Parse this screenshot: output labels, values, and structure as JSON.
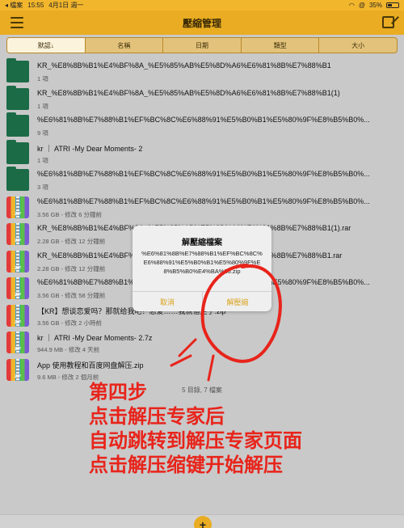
{
  "status_bar": {
    "left_items": [
      "◂ 檔案",
      "15:55",
      "4月1日 週一"
    ],
    "wifi": "wifi-icon",
    "compass": "@",
    "battery": "35%"
  },
  "nav": {
    "title": "壓縮管理",
    "left_icon": "menu-icon",
    "right_icon": "compose-icon"
  },
  "tabs": [
    {
      "label": "默認↓",
      "active": true
    },
    {
      "label": "名稱",
      "active": false
    },
    {
      "label": "日期",
      "active": false
    },
    {
      "label": "類型",
      "active": false
    },
    {
      "label": "大小",
      "active": false
    }
  ],
  "files": [
    {
      "type": "folder",
      "name": "KR_%E8%8B%B1%E4%BF%8A_%E5%85%AB%E5%8D%A6%E6%81%8B%E7%88%B1",
      "sub": "1 項"
    },
    {
      "type": "folder",
      "name": "KR_%E8%8B%B1%E4%BF%8A_%E5%85%AB%E5%8D%A6%E6%81%8B%E7%88%B1(1)",
      "sub": "1 項"
    },
    {
      "type": "folder",
      "name": "%E6%81%8B%E7%88%B1%EF%BC%8C%E6%88%91%E5%B0%B1%E5%80%9F%E8%B5%B0%...",
      "sub": "9 項"
    },
    {
      "type": "folder",
      "name": "kr ｜ ATRI -My Dear Moments- 2",
      "sub": "1 項"
    },
    {
      "type": "folder",
      "name": "%E6%81%8B%E7%88%B1%EF%BC%8C%E6%88%91%E5%B0%B1%E5%80%9F%E8%B5%B0%...",
      "sub": "3 項"
    },
    {
      "type": "zip",
      "name": "%E6%81%8B%E7%88%B1%EF%BC%8C%E6%88%91%E5%B0%B1%E5%80%9F%E8%B5%B0%...",
      "sub": "3.56 GB - 修改 6 分鐘前"
    },
    {
      "type": "zip",
      "name": "KR_%E8%8B%B1%E4%BF%8A_%E5%85%AB%E5%8D%A6%E6%81%8B%E7%88%B1(1).rar",
      "sub": "2.28 GB - 修改 12 分鐘前"
    },
    {
      "type": "zip",
      "name": "KR_%E8%8B%B1%E4%BF%8A_%E5%85%AB%E5%8D%A6%E6%81%8B%E7%88%B1.rar",
      "sub": "2.28 GB - 修改 12 分鐘前"
    },
    {
      "type": "zip",
      "name": "%E6%81%8B%E7%88%B1%EF%BC%8C%E6%88%91%E5%B0%B1%E5%80%9F%E8%B5%B0%...",
      "sub": "3.56 GB - 修改 58 分鐘前"
    },
    {
      "type": "zip",
      "name": "【KR】想谈恋爱吗？那就给我吧！恋爱……我就借走了.zip",
      "sub": "3.56 GB - 修改 2 小時前"
    },
    {
      "type": "zip",
      "name": "kr ｜ ATRI -My Dear Moments- 2.7z",
      "sub": "944.9 MB - 修改 4 天前"
    },
    {
      "type": "zip",
      "name": "App 使用教程和百度网盘解压.zip",
      "sub": "9.6 MB - 修改 2 個月前"
    }
  ],
  "zip_badge": "ZIP",
  "summary": "5 目錄, 7 檔案",
  "dialog": {
    "title": "解壓縮檔案",
    "message": "%E6%81%8B%E7%88%B1%EF%BC%8C%E6%88%91%E5%B0%B1%E5%80%9F%E8%B5%B0%E4%BA%86.zip",
    "cancel": "取消",
    "confirm": "解壓縮"
  },
  "annotation": [
    "第四步",
    "点击解压专家后",
    "自动跳转到解压专家页面",
    "点击解压缩键开始解压"
  ],
  "fab": "+",
  "colors": {
    "accent": "#e9ac22",
    "folder": "#1b6b47",
    "annotation": "#e8241b"
  }
}
